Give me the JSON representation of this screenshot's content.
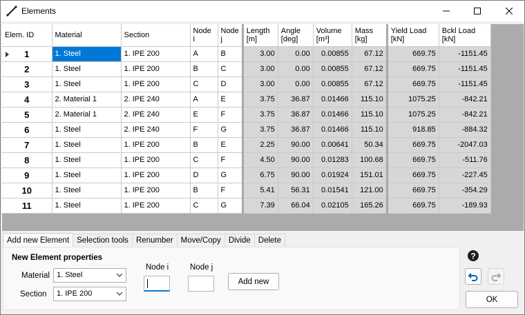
{
  "window": {
    "title": "Elements"
  },
  "columns": [
    "Elem. ID",
    "Material",
    "Section",
    "Node\ni",
    "Node\nj",
    "Length\n[m]",
    "Angle\n[deg]",
    "Volume\n[m³]",
    "Mass\n[kg]",
    "Yield Load\n[kN]",
    "Bckl Load\n[kN]"
  ],
  "rows": [
    [
      "1",
      "1. Steel",
      "1. IPE 200",
      "A",
      "B",
      "3.00",
      "0.00",
      "0.00855",
      "67.12",
      "669.75",
      "-1151.45"
    ],
    [
      "2",
      "1. Steel",
      "1. IPE 200",
      "B",
      "C",
      "3.00",
      "0.00",
      "0.00855",
      "67.12",
      "669.75",
      "-1151.45"
    ],
    [
      "3",
      "1. Steel",
      "1. IPE 200",
      "C",
      "D",
      "3.00",
      "0.00",
      "0.00855",
      "67.12",
      "669.75",
      "-1151.45"
    ],
    [
      "4",
      "2. Material 1",
      "2. IPE 240",
      "A",
      "E",
      "3.75",
      "36.87",
      "0.01466",
      "115.10",
      "1075.25",
      "-842.21"
    ],
    [
      "5",
      "2. Material 1",
      "2. IPE 240",
      "E",
      "F",
      "3.75",
      "36.87",
      "0.01466",
      "115.10",
      "1075.25",
      "-842.21"
    ],
    [
      "6",
      "1. Steel",
      "2. IPE 240",
      "F",
      "G",
      "3.75",
      "36.87",
      "0.01466",
      "115.10",
      "918.85",
      "-884.32"
    ],
    [
      "7",
      "1. Steel",
      "1. IPE 200",
      "B",
      "E",
      "2.25",
      "90.00",
      "0.00641",
      "50.34",
      "669.75",
      "-2047.03"
    ],
    [
      "8",
      "1. Steel",
      "1. IPE 200",
      "C",
      "F",
      "4.50",
      "90.00",
      "0.01283",
      "100.68",
      "669.75",
      "-511.76"
    ],
    [
      "9",
      "1. Steel",
      "1. IPE 200",
      "D",
      "G",
      "6.75",
      "90.00",
      "0.01924",
      "151.01",
      "669.75",
      "-227.45"
    ],
    [
      "10",
      "1. Steel",
      "1. IPE 200",
      "B",
      "F",
      "5.41",
      "56.31",
      "0.01541",
      "121.00",
      "669.75",
      "-354.29"
    ],
    [
      "11",
      "1. Steel",
      "1. IPE 200",
      "C",
      "G",
      "7.39",
      "66.04",
      "0.02105",
      "165.26",
      "669.75",
      "-189.93"
    ]
  ],
  "tabs": [
    "Add new Element",
    "Selection tools",
    "Renumber",
    "Move/Copy",
    "Divide",
    "Delete"
  ],
  "panel": {
    "title": "New Element properties",
    "material_label": "Material",
    "material_value": "1. Steel",
    "section_label": "Section",
    "section_value": "1. IPE 200",
    "node_i_label": "Node i",
    "node_j_label": "Node j",
    "node_i_value": "",
    "node_j_value": "",
    "add_button": "Add new"
  },
  "ok_button": "OK",
  "colors": {
    "selection": "#0078d7",
    "grid_bg": "#ababab",
    "readonly_cell": "#d7d7d7"
  }
}
